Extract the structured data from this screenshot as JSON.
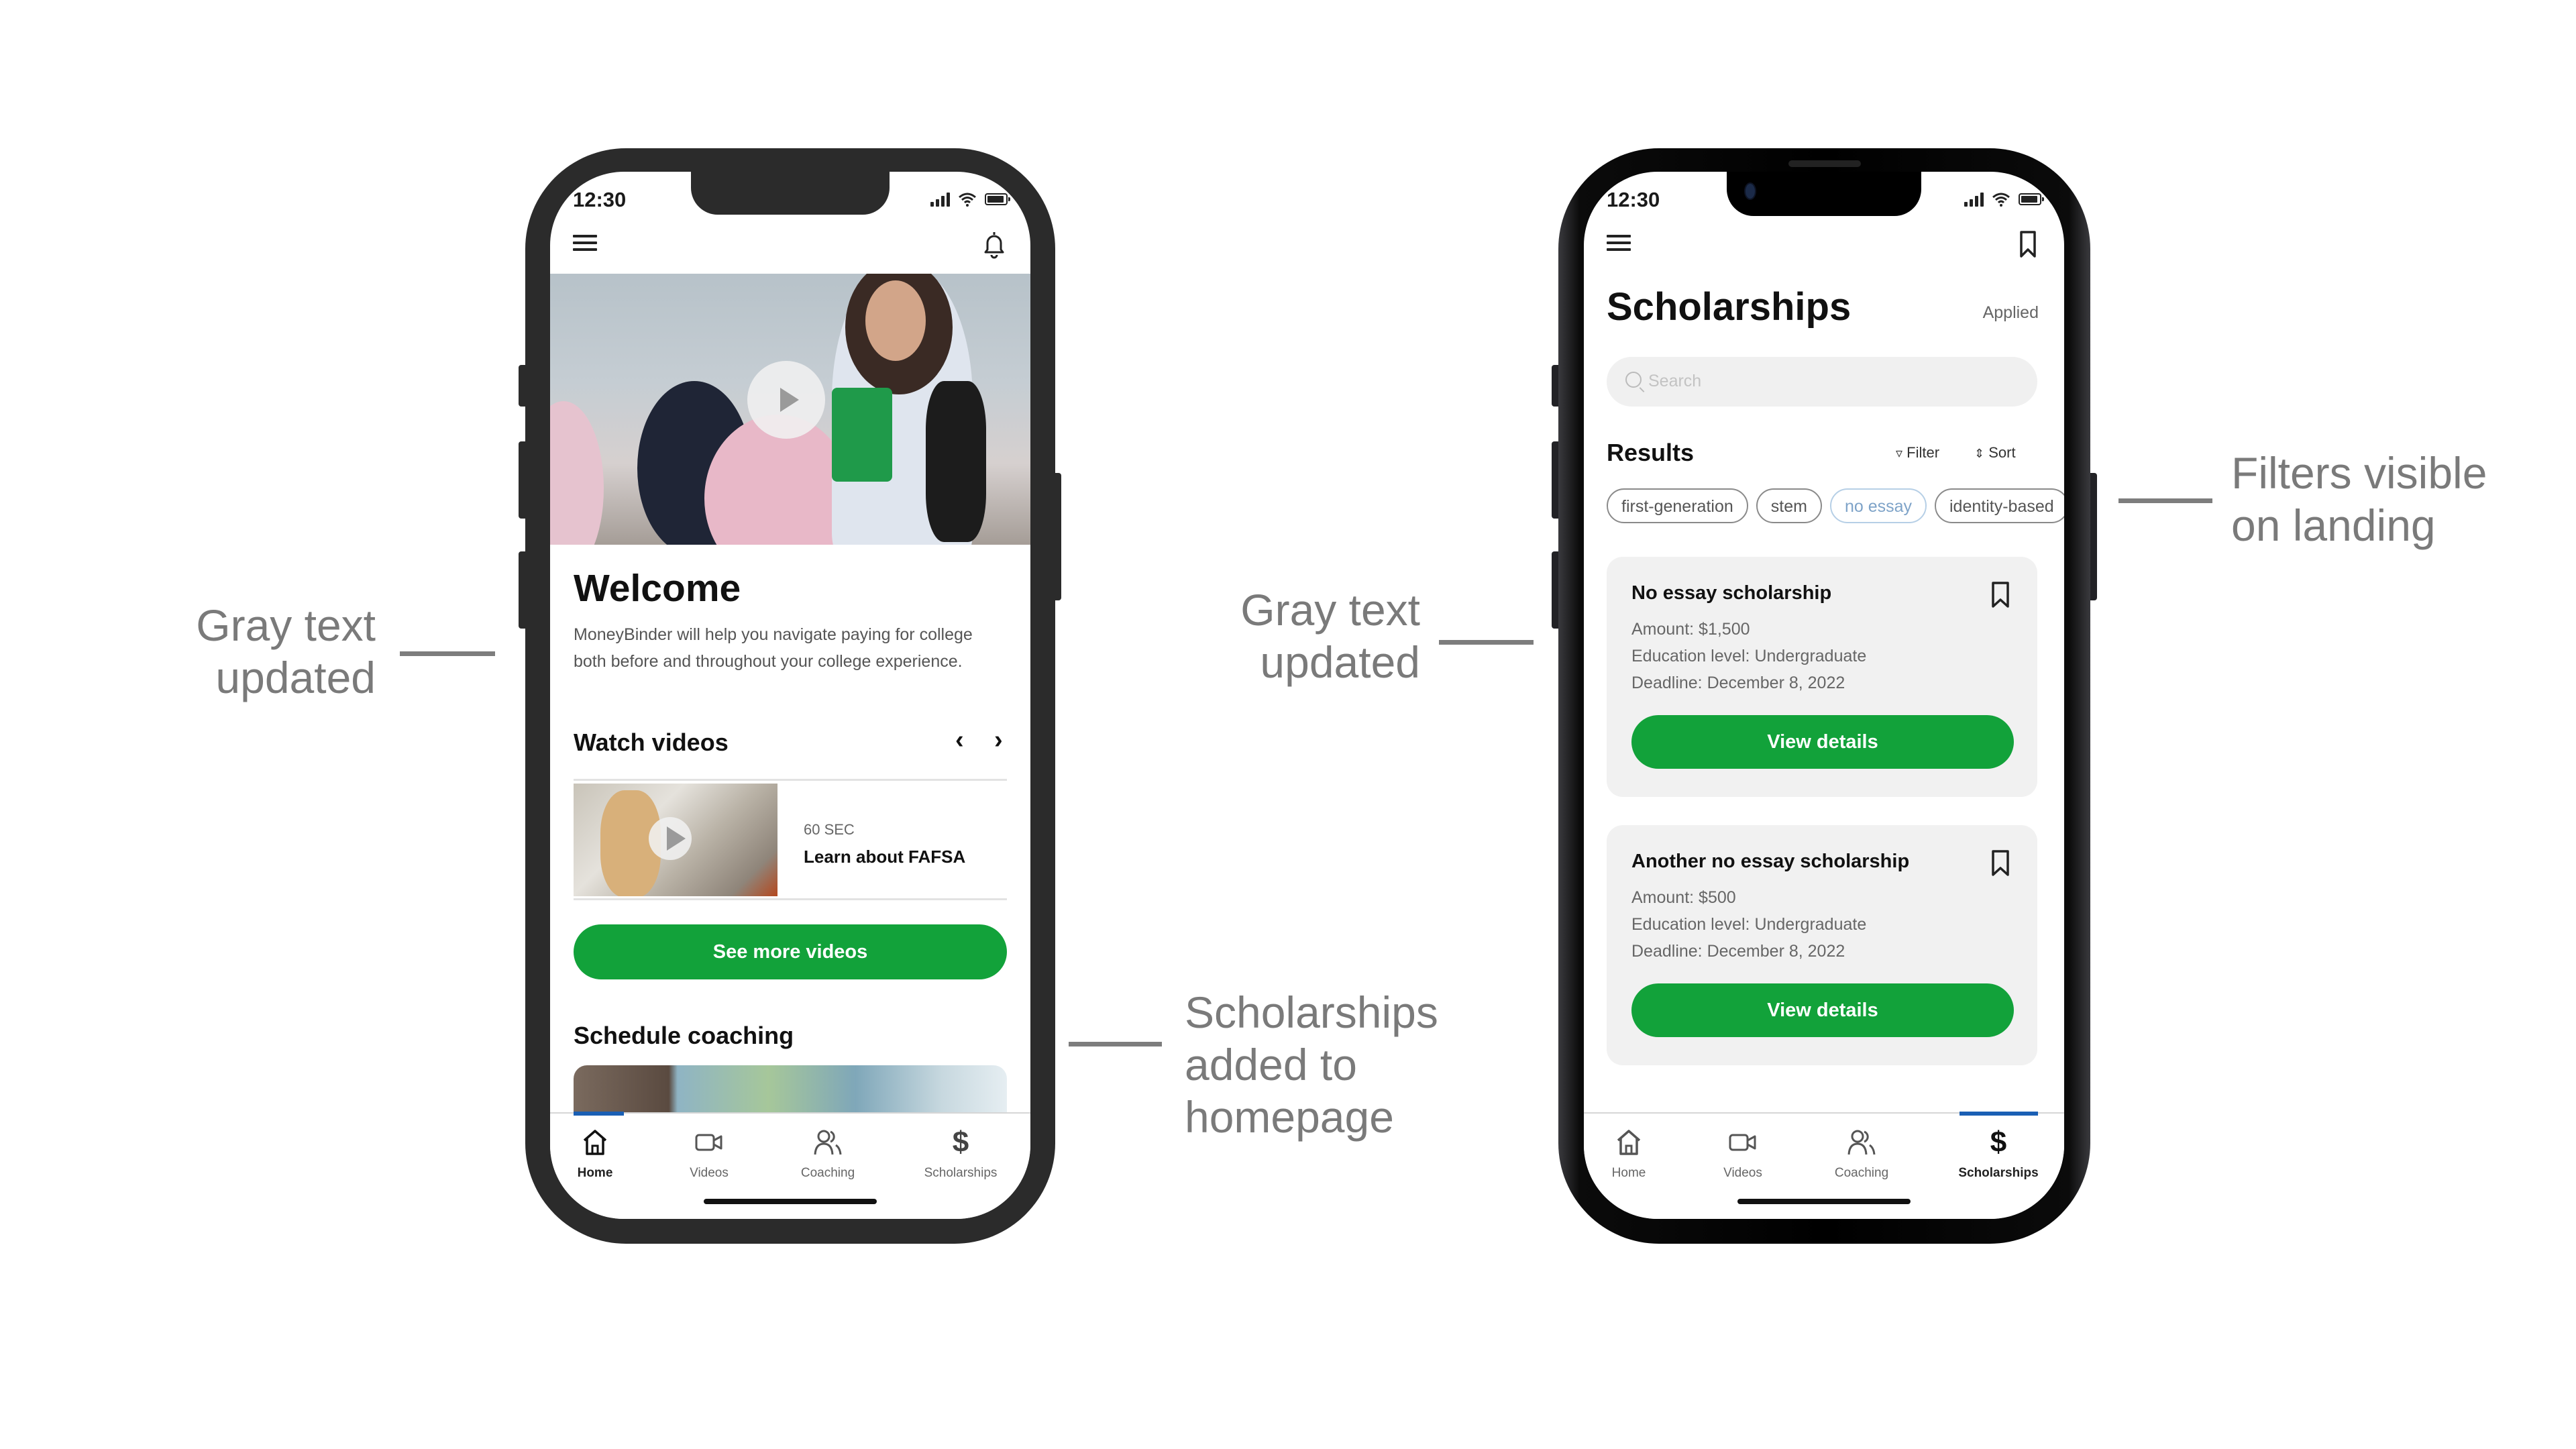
{
  "annotations": {
    "left_gray_text": [
      "Gray text",
      "updated"
    ],
    "middle_gray_text": [
      "Gray text",
      "updated"
    ],
    "scholarships_added": [
      "Scholarships",
      "added to",
      "homepage"
    ],
    "filters_visible": [
      "Filters visible",
      "on landing"
    ]
  },
  "colors": {
    "primary_green": "#12a23a",
    "annotation_gray": "#7a7a7a",
    "active_tab_indicator": "#1a5fb4",
    "selected_chip": "#7ea3c8"
  },
  "home_screen": {
    "status_bar": {
      "time": "12:30",
      "icons": [
        "signal-icon",
        "wifi-icon",
        "battery-icon"
      ]
    },
    "top_bar": {
      "left_icon": "hamburger-menu-icon",
      "right_icon": "bell-icon"
    },
    "hero": {
      "icon": "play-icon"
    },
    "welcome_title": "Welcome",
    "welcome_text": "MoneyBinder will help you navigate paying for college both before and throughout your college experience.",
    "watch_videos": {
      "title": "Watch videos",
      "prev_icon": "chevron-left-icon",
      "next_icon": "chevron-right-icon",
      "video": {
        "duration": "60 SEC",
        "title": "Learn about FAFSA"
      },
      "button_label": "See more videos"
    },
    "schedule_coaching": {
      "title": "Schedule coaching"
    },
    "tabs": [
      {
        "label": "Home",
        "icon": "home-icon",
        "active": true
      },
      {
        "label": "Videos",
        "icon": "video-camera-icon",
        "active": false
      },
      {
        "label": "Coaching",
        "icon": "people-icon",
        "active": false
      },
      {
        "label": "Scholarships",
        "icon": "dollar-icon",
        "active": false
      }
    ]
  },
  "scholarships_screen": {
    "status_bar": {
      "time": "12:30",
      "icons": [
        "signal-icon",
        "wifi-icon",
        "battery-icon"
      ]
    },
    "top_bar": {
      "left_icon": "hamburger-menu-icon",
      "right_icon": "bookmark-icon"
    },
    "title": "Scholarships",
    "applied_label": "Applied",
    "search": {
      "placeholder": "Search",
      "value": ""
    },
    "results_label": "Results",
    "filter_label": "Filter",
    "sort_label": "Sort",
    "chips": [
      {
        "label": "first-generation",
        "selected": false
      },
      {
        "label": "stem",
        "selected": false
      },
      {
        "label": "no essay",
        "selected": true
      },
      {
        "label": "identity-based",
        "selected": false
      }
    ],
    "cards": [
      {
        "title": "No essay scholarship",
        "amount": "Amount: $1,500",
        "education_level": "Education level: Undergraduate",
        "deadline": "Deadline: December 8, 2022",
        "button_label": "View details"
      },
      {
        "title": "Another no essay scholarship",
        "amount": "Amount: $500",
        "education_level": "Education level: Undergraduate",
        "deadline": "Deadline: December 8, 2022",
        "button_label": "View details"
      }
    ],
    "tabs": [
      {
        "label": "Home",
        "icon": "home-icon",
        "active": false
      },
      {
        "label": "Videos",
        "icon": "video-camera-icon",
        "active": false
      },
      {
        "label": "Coaching",
        "icon": "people-icon",
        "active": false
      },
      {
        "label": "Scholarships",
        "icon": "dollar-icon",
        "active": true
      }
    ]
  }
}
